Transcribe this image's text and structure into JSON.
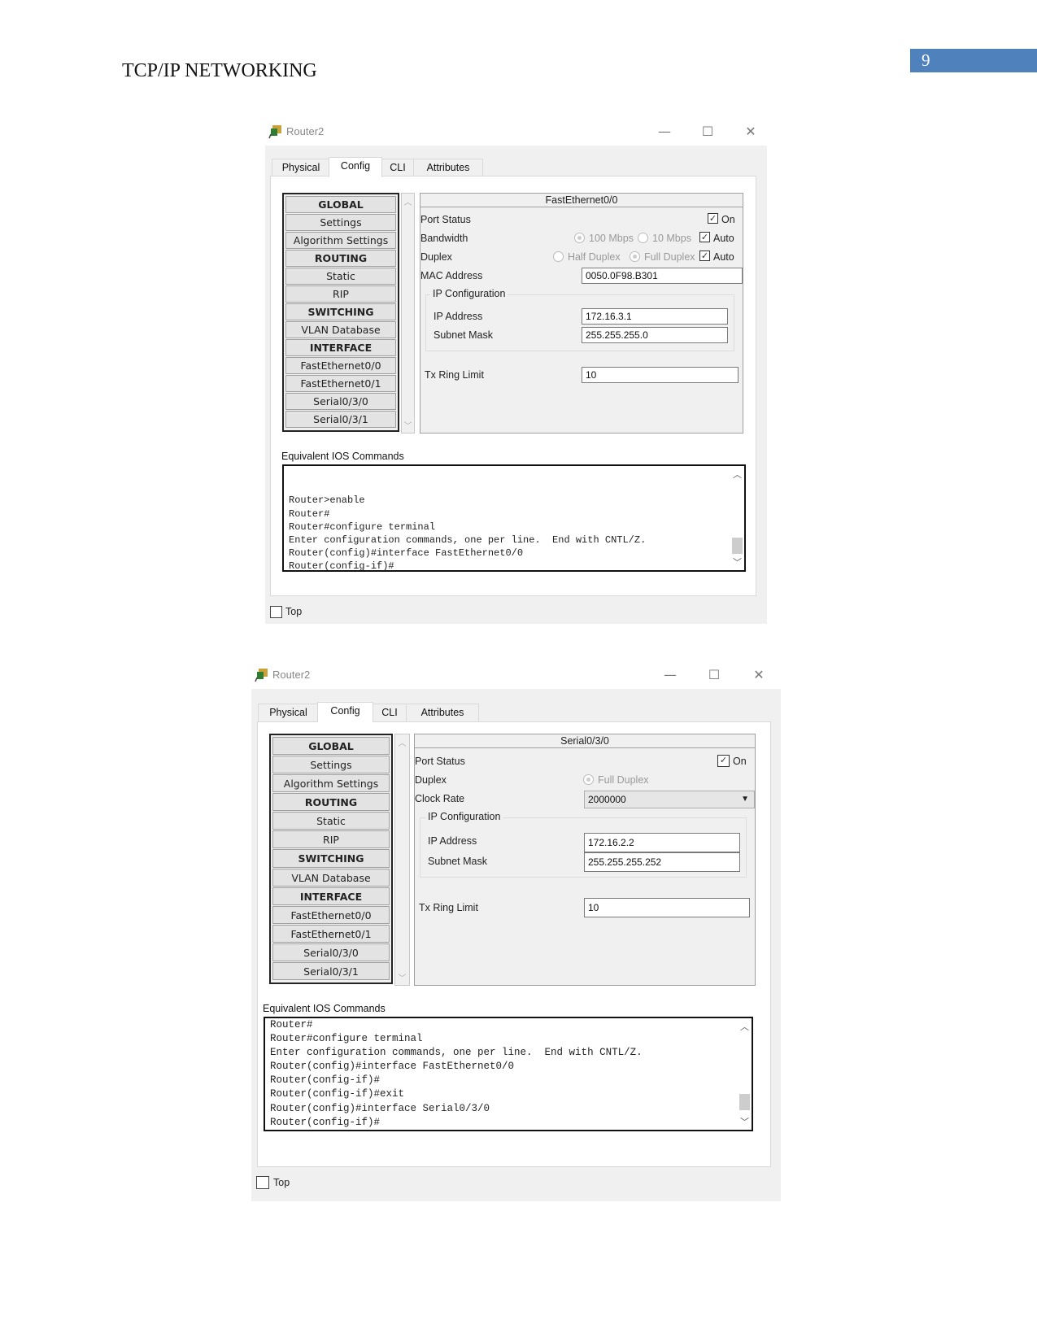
{
  "page": {
    "header_title": "TCP/IP NETWORKING",
    "page_number": "9",
    "accent_color": "#4f81bd"
  },
  "windows": [
    {
      "title": "Router2",
      "title_icon": "router-icon",
      "controls": {
        "minimize": "—",
        "maximize": "☐",
        "close": "✕"
      },
      "tabs": [
        {
          "label": "Physical",
          "active": false
        },
        {
          "label": "Config",
          "active": true
        },
        {
          "label": "CLI",
          "active": false
        },
        {
          "label": "Attributes",
          "active": false
        }
      ],
      "nav_items": [
        {
          "label": "GLOBAL",
          "header": true
        },
        {
          "label": "Settings",
          "header": false
        },
        {
          "label": "Algorithm Settings",
          "header": false
        },
        {
          "label": "ROUTING",
          "header": true
        },
        {
          "label": "Static",
          "header": false
        },
        {
          "label": "RIP",
          "header": false
        },
        {
          "label": "SWITCHING",
          "header": true
        },
        {
          "label": "VLAN Database",
          "header": false
        },
        {
          "label": "INTERFACE",
          "header": true
        },
        {
          "label": "FastEthernet0/0",
          "header": false
        },
        {
          "label": "FastEthernet0/1",
          "header": false
        },
        {
          "label": "Serial0/3/0",
          "header": false
        },
        {
          "label": "Serial0/3/1",
          "header": false
        }
      ],
      "panel": {
        "title": "FastEthernet0/0",
        "port_status_label": "Port Status",
        "port_status_on_label": "On",
        "port_status_on": true,
        "bandwidth_label": "Bandwidth",
        "bandwidth_options": [
          "100 Mbps",
          "10 Mbps"
        ],
        "bandwidth_selected": "100 Mbps",
        "bandwidth_auto_label": "Auto",
        "bandwidth_auto": true,
        "duplex_label": "Duplex",
        "duplex_options": [
          "Half Duplex",
          "Full Duplex"
        ],
        "duplex_selected": "Full Duplex",
        "duplex_auto_label": "Auto",
        "duplex_auto": true,
        "mac_label": "MAC Address",
        "mac_value": "0050.0F98.B301",
        "ip_config_label": "IP Configuration",
        "ip_label": "IP Address",
        "ip_value": "172.16.3.1",
        "mask_label": "Subnet Mask",
        "mask_value": "255.255.255.0",
        "tx_label": "Tx Ring Limit",
        "tx_value": "10"
      },
      "ios_label": "Equivalent IOS Commands",
      "ios_lines": [
        "",
        "",
        "Router>enable",
        "Router#",
        "Router#configure terminal",
        "Enter configuration commands, one per line.  End with CNTL/Z.",
        "Router(config)#interface FastEthernet0/0",
        "Router(config-if)#"
      ],
      "top_label": "Top",
      "top_checked": false
    },
    {
      "title": "Router2",
      "title_icon": "router-icon",
      "controls": {
        "minimize": "—",
        "maximize": "☐",
        "close": "✕"
      },
      "tabs": [
        {
          "label": "Physical",
          "active": false
        },
        {
          "label": "Config",
          "active": true
        },
        {
          "label": "CLI",
          "active": false
        },
        {
          "label": "Attributes",
          "active": false
        }
      ],
      "nav_items": [
        {
          "label": "GLOBAL",
          "header": true
        },
        {
          "label": "Settings",
          "header": false
        },
        {
          "label": "Algorithm Settings",
          "header": false
        },
        {
          "label": "ROUTING",
          "header": true
        },
        {
          "label": "Static",
          "header": false
        },
        {
          "label": "RIP",
          "header": false
        },
        {
          "label": "SWITCHING",
          "header": true
        },
        {
          "label": "VLAN Database",
          "header": false
        },
        {
          "label": "INTERFACE",
          "header": true
        },
        {
          "label": "FastEthernet0/0",
          "header": false
        },
        {
          "label": "FastEthernet0/1",
          "header": false
        },
        {
          "label": "Serial0/3/0",
          "header": false
        },
        {
          "label": "Serial0/3/1",
          "header": false
        }
      ],
      "panel": {
        "title": "Serial0/3/0",
        "port_status_label": "Port Status",
        "port_status_on_label": "On",
        "port_status_on": true,
        "duplex_label": "Duplex",
        "duplex_option": "Full Duplex",
        "clock_rate_label": "Clock Rate",
        "clock_rate_value": "2000000",
        "ip_config_label": "IP Configuration",
        "ip_label": "IP Address",
        "ip_value": "172.16.2.2",
        "mask_label": "Subnet Mask",
        "mask_value": "255.255.255.252",
        "tx_label": "Tx Ring Limit",
        "tx_value": "10"
      },
      "ios_label": "Equivalent IOS Commands",
      "ios_lines": [
        "Router#",
        "Router#configure terminal",
        "Enter configuration commands, one per line.  End with CNTL/Z.",
        "Router(config)#interface FastEthernet0/0",
        "Router(config-if)#",
        "Router(config-if)#exit",
        "Router(config)#interface Serial0/3/0",
        "Router(config-if)#"
      ],
      "top_label": "Top",
      "top_checked": false
    }
  ]
}
